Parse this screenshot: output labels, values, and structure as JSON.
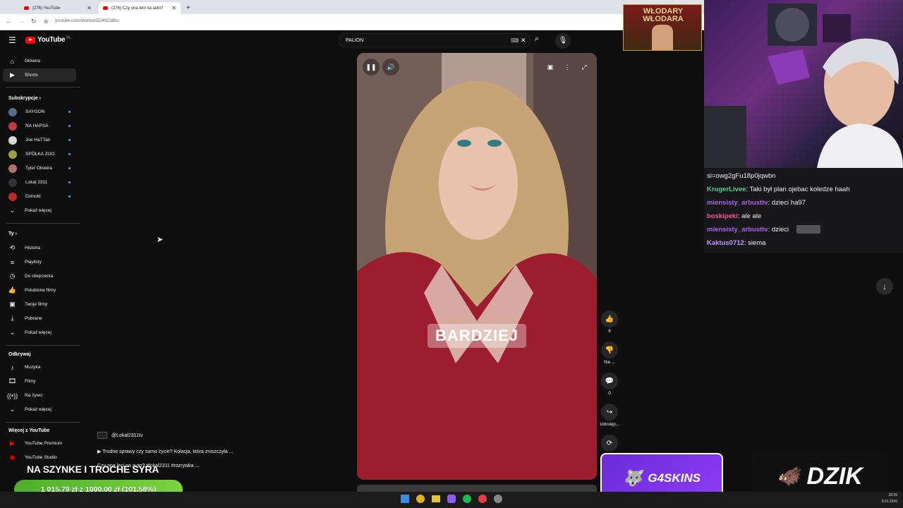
{
  "browser": {
    "tabs": [
      {
        "title": "(276) YouTube"
      },
      {
        "title": "(276) Czy ona leci na auto?"
      }
    ],
    "url": "youtube.com/shorts/et224NCd8ko"
  },
  "youtube": {
    "logo_text": "YouTube",
    "logo_region": "PL",
    "search_query": "PALION"
  },
  "sidebar": {
    "main": [
      {
        "label": "Główna",
        "icon": "home-icon"
      },
      {
        "label": "Shorts",
        "icon": "shorts-icon"
      }
    ],
    "subs_header": "Subskrypcje",
    "subscriptions": [
      {
        "label": "SAYGON",
        "color": "#5a6b8c"
      },
      {
        "label": "NA HAPSA",
        "color": "#c43a3a"
      },
      {
        "label": "Joe HaTTab",
        "color": "#d8d8d8"
      },
      {
        "label": "SPÓŁKA ZOO",
        "color": "#a0a040"
      },
      {
        "label": "Tyler Oliveira",
        "color": "#b07070"
      },
      {
        "label": "Lokal 2311",
        "color": "#333333"
      },
      {
        "label": "Dzinold",
        "color": "#c02828"
      }
    ],
    "subs_more": "Pokaż więcej",
    "you_header": "Ty",
    "you": [
      {
        "label": "Historia",
        "icon": "history-icon"
      },
      {
        "label": "Playlisty",
        "icon": "playlist-icon"
      },
      {
        "label": "Do obejrzenia",
        "icon": "watch-later-icon"
      },
      {
        "label": "Polubione filmy",
        "icon": "like-icon"
      },
      {
        "label": "Twoje filmy",
        "icon": "your-videos-icon"
      },
      {
        "label": "Pobrane",
        "icon": "download-icon"
      }
    ],
    "you_more": "Pokaż więcej",
    "explore_header": "Odkrywaj",
    "explore": [
      {
        "label": "Muzyka",
        "icon": "music-icon"
      },
      {
        "label": "Filmy",
        "icon": "movies-icon"
      },
      {
        "label": "Na żywo",
        "icon": "live-icon"
      }
    ],
    "explore_more": "Pokaż więcej",
    "more_header": "Więcej z YouTube",
    "more": [
      {
        "label": "YouTube Premium"
      },
      {
        "label": "YouTube Studio"
      }
    ]
  },
  "short": {
    "caption": "BARDZIEJ",
    "channel": "@Lokal2311tv",
    "description": "▶ Trudne sprawy czy samo życie? Kolacja, która zniszczyła ...",
    "description2": "Czy ona leci na auto? #lokal2311 #rozrywka ...",
    "likes": "6",
    "dislike_label": "Nie ...",
    "comments": "0",
    "share_label": "Udostęp..."
  },
  "stream": {
    "banner_text": "WŁODARY WŁODARA",
    "overlay_title": "NA SZYNKE I TROCHE SYRA",
    "goal_text": "1 015,79 zł z 1000,00 zł (101.58%)",
    "goal_progress": 1.0158,
    "sponsor1": "G4SKINS",
    "sponsor2": "DZIK",
    "chat": [
      {
        "user": "",
        "text": "si=owg2gFu18p0jqwbn",
        "color": "#efeff1"
      },
      {
        "user": "KrugerLivee",
        "text": ": Taki był plan ojebac koledze haah",
        "color": "#48d597"
      },
      {
        "user": "miensisty_arbusttv",
        "text": ": dzieci ha97",
        "color": "#b05cf0"
      },
      {
        "user": "boskipeki",
        "text": ": ale ale",
        "color": "#ff4f9a"
      },
      {
        "user": "miensisty_arbusttv",
        "text": ": dzieci",
        "color": "#b05cf0"
      },
      {
        "user": "Kaktus0712",
        "text": ": siema",
        "color": "#c693ff"
      }
    ]
  },
  "taskbar": {
    "time": "18:26",
    "date": "8.01.2026"
  }
}
